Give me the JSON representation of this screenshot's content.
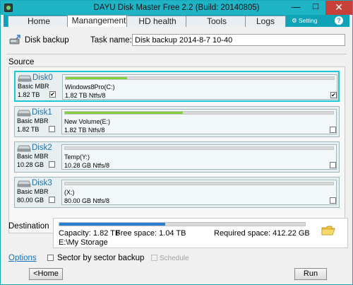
{
  "window": {
    "title": "DAYU Disk Master Free 2.2  (Build: 20140805)",
    "min_glyph": "—",
    "max_glyph": "☐",
    "close_glyph": "✕"
  },
  "tabs": [
    {
      "label": "Home"
    },
    {
      "label": "Manangement"
    },
    {
      "label": "HD health"
    },
    {
      "label": "Tools"
    },
    {
      "label": "Logs"
    }
  ],
  "tab_extras": {
    "setting_label": "⚙ Setting",
    "help_glyph": "?"
  },
  "task": {
    "title": "Disk backup",
    "name_label": "Task name:",
    "name_value": "Disk backup 2014-8-7 10-40"
  },
  "source": {
    "label": "Source",
    "disks": [
      {
        "name": "Disk0",
        "type": "Basic MBR",
        "size": "1.82 TB",
        "disk_checked": true,
        "partition_name": "Windows8Pro(C:)",
        "partition_info": "1.82 TB Ntfs/8",
        "partition_checked": true,
        "used_fraction": 0.23,
        "selected": true
      },
      {
        "name": "Disk1",
        "type": "Basic MBR",
        "size": "1.82 TB",
        "disk_checked": false,
        "partition_name": "New Volume(E:)",
        "partition_info": "1.82 TB Ntfs/8",
        "partition_checked": false,
        "used_fraction": 0.44,
        "selected": false
      },
      {
        "name": "Disk2",
        "type": "Basic MBR",
        "size": "10.28 GB",
        "disk_checked": false,
        "partition_name": "Temp(Y:)",
        "partition_info": "10.28 GB Ntfs/8",
        "partition_checked": false,
        "used_fraction": 0.0,
        "selected": false
      },
      {
        "name": "Disk3",
        "type": "Basic MBR",
        "size": "80.00 GB",
        "disk_checked": false,
        "partition_name": "(X:)",
        "partition_info": "80.00 GB Ntfs/8",
        "partition_checked": false,
        "used_fraction": 0.0,
        "selected": false
      }
    ]
  },
  "destination": {
    "label": "Destination",
    "capacity": "Capacity: 1.82 TB",
    "free_space": "Free space: 1.04 TB",
    "required_space": "Required space: 412.22 GB",
    "path": "E:\\My Storage",
    "used_fraction": 0.43
  },
  "options": {
    "link_label": "Options",
    "sector_label": "Sector by sector backup",
    "sector_checked": false,
    "schedule_label": "Schedule",
    "schedule_enabled": false
  },
  "footer": {
    "home_label": "<Home",
    "run_label": "Run"
  },
  "colors": {
    "titlebar": "#1fb3c6",
    "selected_border": "#1fc6d6",
    "partition_used": "#7fcf3e",
    "destination_used": "#2a7fd0"
  }
}
